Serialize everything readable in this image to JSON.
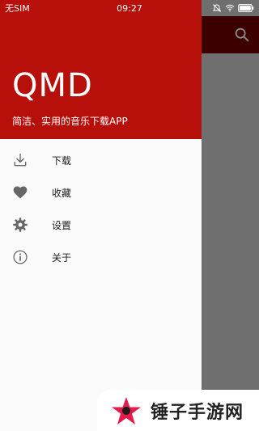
{
  "status_bar": {
    "carrier": "无SIM",
    "time": "09:27",
    "icons": [
      "alarm-off-icon",
      "wifi-icon",
      "battery-icon"
    ]
  },
  "app_bar": {
    "search_icon": "search-icon"
  },
  "drawer": {
    "header": {
      "app_name": "QMD",
      "description": "简洁、实用的音乐下载APP"
    },
    "items": [
      {
        "label": "下载",
        "icon": "download-icon"
      },
      {
        "label": "收藏",
        "icon": "heart-icon"
      },
      {
        "label": "设置",
        "icon": "gear-icon"
      },
      {
        "label": "关于",
        "icon": "info-icon"
      }
    ]
  },
  "watermark": {
    "text": "锤子手游网"
  },
  "colors": {
    "drawer_header": "#b70f0a",
    "background_scrim": "#6f6f6f",
    "app_bar_dimmed": "#3d0000",
    "icon_gray": "#666666"
  }
}
